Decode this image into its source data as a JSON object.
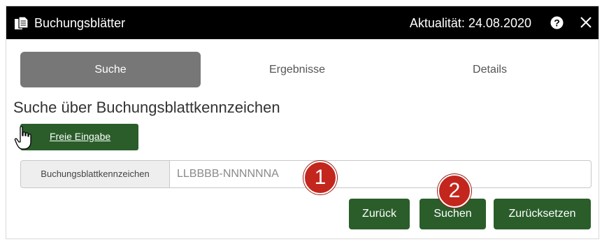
{
  "window": {
    "title": "Buchungsblätter",
    "actuality": "Aktualität: 24.08.2020",
    "title_icon": "documents-icon",
    "help_icon": "help-icon",
    "close_icon": "close-icon"
  },
  "tabs": [
    {
      "label": "Suche",
      "active": true
    },
    {
      "label": "Ergebnisse",
      "active": false
    },
    {
      "label": "Details",
      "active": false
    }
  ],
  "section_title": "Suche über Buchungsblattkennzeichen",
  "free_input_button": {
    "label": "Freie Eingabe",
    "icon": "hand-pointer-icon"
  },
  "search_field": {
    "label": "Buchungsblattkennzeichen",
    "placeholder": "LLBBBB-NNNNNNA",
    "value": ""
  },
  "buttons": {
    "back": "Zurück",
    "search": "Suchen",
    "reset": "Zurücksetzen"
  },
  "callouts": [
    "1",
    "2"
  ],
  "colors": {
    "titlebar": "#000000",
    "active_tab": "#777777",
    "button_green": "#2a5d2a",
    "callout_red": "#c3261d"
  }
}
